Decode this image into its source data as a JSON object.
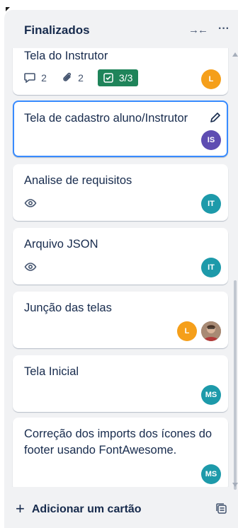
{
  "list": {
    "title": "Finalizados",
    "collapse_icon": "→←",
    "menu_icon": "···"
  },
  "cards": [
    {
      "title": "Tela do Instrutor",
      "comments": "2",
      "attachments": "2",
      "checklist": "3/3",
      "members": [
        {
          "initials": "L",
          "color": "#f59f1a"
        }
      ]
    },
    {
      "title": "Tela de cadastro aluno/Instrutor",
      "members": [
        {
          "initials": "IS",
          "color": "#5e4db2"
        }
      ]
    },
    {
      "title": "Analise de requisitos",
      "members": [
        {
          "initials": "IT",
          "color": "#1d9aaa"
        }
      ]
    },
    {
      "title": "Arquivo JSON",
      "members": [
        {
          "initials": "IT",
          "color": "#1d9aaa"
        }
      ]
    },
    {
      "title": "Junção das telas",
      "members": [
        {
          "initials": "L",
          "color": "#f59f1a"
        },
        {
          "initials": "",
          "color": "#8b6e5a"
        }
      ]
    },
    {
      "title": "Tela Inicial",
      "members": [
        {
          "initials": "MS",
          "color": "#1d9aaa"
        }
      ]
    },
    {
      "title": "Correção dos imports dos ícones do footer usando FontAwesome.",
      "members": [
        {
          "initials": "MS",
          "color": "#1d9aaa"
        }
      ]
    }
  ],
  "footer": {
    "add_label": "Adicionar um cartão",
    "plus": "+"
  }
}
